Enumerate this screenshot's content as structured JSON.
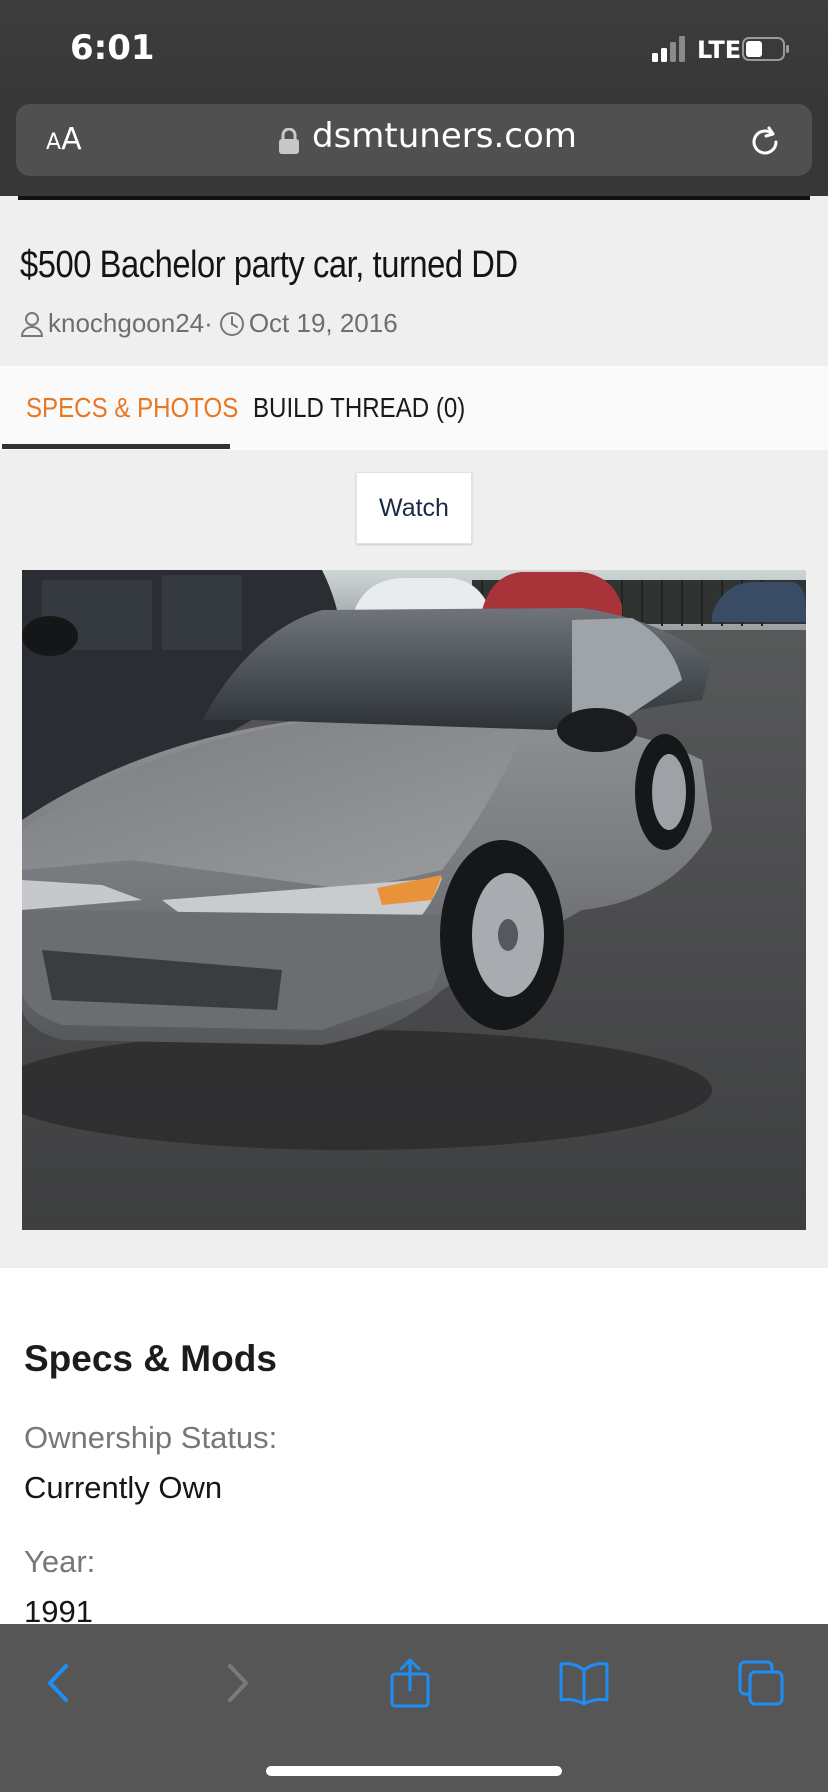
{
  "status_bar": {
    "time": "6:01",
    "network": "LTE"
  },
  "browser": {
    "text_size_label_small": "A",
    "text_size_label_large": "A",
    "domain": "dsmtuners.com"
  },
  "post": {
    "title": "$500 Bachelor party car, turned DD",
    "author": "knochgoon24",
    "separator": "·",
    "date": "Oct 19, 2016"
  },
  "tabs": [
    {
      "label": "SPECS & PHOTOS",
      "active": true
    },
    {
      "label": "BUILD THREAD (0)",
      "active": false
    }
  ],
  "watch_label": "Watch",
  "specs": {
    "heading": "Specs & Mods",
    "items": [
      {
        "label": "Ownership Status:",
        "value": "Currently Own"
      },
      {
        "label": "Year:",
        "value": "1991"
      }
    ]
  },
  "colors": {
    "accent": "#e87722",
    "ios_blue": "#1e8ef5",
    "chrome_dark": "#373737"
  },
  "toolbar": {
    "icons": [
      "back-icon",
      "forward-icon",
      "share-icon",
      "bookmarks-icon",
      "tabs-icon"
    ]
  }
}
